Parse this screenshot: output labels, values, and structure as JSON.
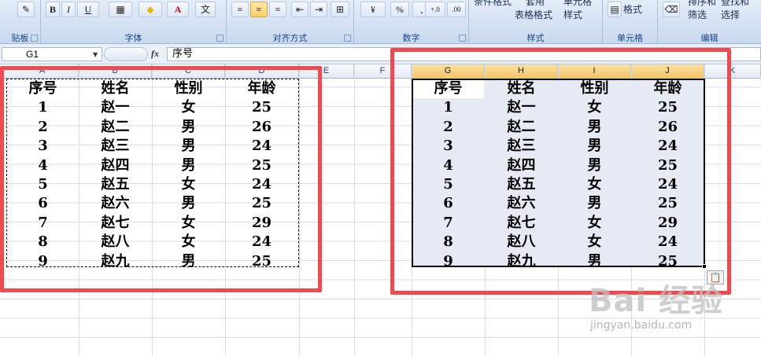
{
  "ribbon": {
    "groups": [
      {
        "label": "贴板"
      },
      {
        "label": "字体"
      },
      {
        "label": "对齐方式"
      },
      {
        "label": "数字"
      },
      {
        "label": "样式"
      },
      {
        "label": "单元格"
      },
      {
        "label": "编辑"
      }
    ],
    "font_buttons": {
      "bold": "B",
      "italic": "I",
      "underline": "U"
    },
    "number": {
      "percent": "%",
      "comma": ",",
      "inc_decimal": "+.0",
      "dec_decimal": ".00"
    },
    "styles": {
      "conditional": "条件格式",
      "table_top": "套用",
      "table_format": "表格格式",
      "cell_top": "单元格",
      "cell_style": "样式"
    },
    "cells": {
      "format": "格式"
    },
    "editing": {
      "sort_top": "排序和",
      "sort": "筛选",
      "find_top": "查找和",
      "find": "选择"
    }
  },
  "formula_bar": {
    "name_box": "G1",
    "fx_label": "fx",
    "content": "序号"
  },
  "columns": [
    "A",
    "B",
    "C",
    "D",
    "E",
    "F",
    "G",
    "H",
    "I",
    "J",
    "K"
  ],
  "table": {
    "headers": [
      "序号",
      "姓名",
      "性别",
      "年龄"
    ],
    "rows": [
      [
        "1",
        "赵一",
        "女",
        "25"
      ],
      [
        "2",
        "赵二",
        "男",
        "26"
      ],
      [
        "3",
        "赵三",
        "男",
        "24"
      ],
      [
        "4",
        "赵四",
        "男",
        "25"
      ],
      [
        "5",
        "赵五",
        "女",
        "24"
      ],
      [
        "6",
        "赵六",
        "男",
        "25"
      ],
      [
        "7",
        "赵七",
        "女",
        "29"
      ],
      [
        "8",
        "赵八",
        "女",
        "24"
      ],
      [
        "9",
        "赵九",
        "男",
        "25"
      ]
    ]
  },
  "colors": {
    "highlight": "#f04a4f",
    "selected_header": "#f2c463",
    "paste_fill": "#e6eaf4"
  },
  "watermark": {
    "logo": "Bai 经验",
    "url": "jingyan.baidu.com"
  }
}
